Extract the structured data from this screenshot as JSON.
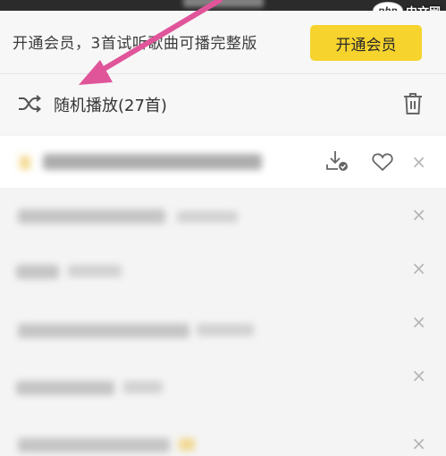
{
  "watermark": {
    "logo": "php",
    "text": "中文网"
  },
  "vip_bar": {
    "promo_text": "开通会员，3首试听歌曲可播完整版",
    "button_label": "开通会员"
  },
  "mode_row": {
    "mode_label": "随机播放(27首)"
  },
  "list": {
    "close_glyph": "×",
    "row_count": 6
  },
  "colors": {
    "accent_yellow": "#f6d32d",
    "arrow_pink": "#e0559a"
  }
}
